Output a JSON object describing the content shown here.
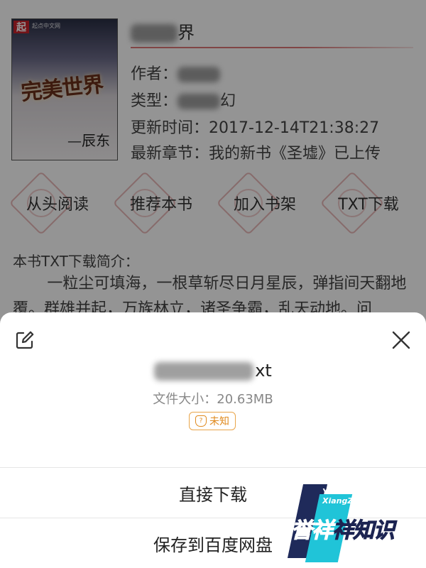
{
  "book": {
    "cover": {
      "logo_char": "起",
      "tag": "起点中文网",
      "title": "完美世界",
      "author": "—辰东"
    },
    "title_suffix": "界",
    "meta": [
      {
        "label": "作者：",
        "value": ""
      },
      {
        "label": "类型：",
        "value": "幻"
      },
      {
        "label": "更新时间：",
        "value": "2017-12-14T21:38:27"
      },
      {
        "label": "最新章节：",
        "value": "我的新书《圣墟》已上传"
      }
    ],
    "actions": [
      "从头阅读",
      "推荐本书",
      "加入书架",
      "TXT下载"
    ],
    "intro_heading": "本书TXT下载简介：",
    "intro_text": "一粒尘可填海，一根草斩尽日月星辰，弹指间天翻地覆。群雄并起，万族林立，诸圣争霸，乱天动地。问"
  },
  "sheet": {
    "file_name_suffix": "xt",
    "file_size": "文件大小：20.63MB",
    "badge": "未知",
    "options": [
      "直接下载",
      "保存到百度网盘"
    ]
  },
  "icons": {
    "edit": "edit-icon",
    "close": "close-icon",
    "badge": "shield-question-icon"
  },
  "watermark": {
    "latin_1": "YuXiang",
    "latin_2": "XiangZhiShi",
    "cjk_1": "誉",
    "cjk_2": "祥",
    "cjk_3": "祥知识"
  },
  "colors": {
    "overlay": "rgba(0,0,0,0.42)",
    "badge": "#e08a1e",
    "accent_red": "#c8232c",
    "watermark_teal": "#20c4d8",
    "watermark_navy": "#1f2a5a"
  }
}
